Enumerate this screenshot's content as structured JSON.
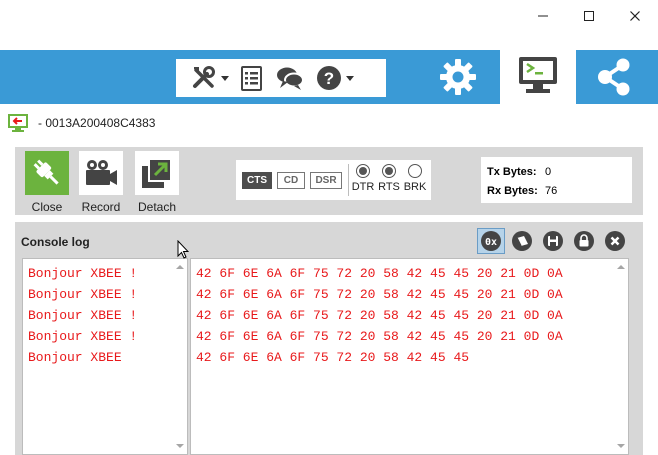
{
  "window": {
    "controls": [
      {
        "name": "minimize-button",
        "icon": "minimize-icon"
      },
      {
        "name": "maximize-button",
        "icon": "maximize-icon"
      },
      {
        "name": "close-window-button",
        "icon": "close-icon"
      }
    ]
  },
  "toolbar": {
    "tools": [
      {
        "icon": "tools-icon",
        "has_dropdown": true
      },
      {
        "icon": "list-icon",
        "has_dropdown": false
      },
      {
        "icon": "chat-icon",
        "has_dropdown": false
      },
      {
        "icon": "help-icon",
        "has_dropdown": true
      }
    ],
    "modes": [
      {
        "icon": "gear-icon",
        "active": false
      },
      {
        "icon": "console-icon",
        "active": true
      },
      {
        "icon": "network-icon",
        "active": false
      }
    ],
    "colors": {
      "band": "#3a9ad6",
      "accent_green": "#6cb33e"
    }
  },
  "device": {
    "name": "- 0013A200408C4383",
    "icon": "device-console-icon"
  },
  "actions": [
    {
      "label": "Close",
      "icon": "plug-icon"
    },
    {
      "label": "Record",
      "icon": "video-camera-icon"
    },
    {
      "label": "Detach",
      "icon": "detach-icon"
    }
  ],
  "signals": {
    "inputs": [
      {
        "label": "CTS",
        "active": true
      },
      {
        "label": "CD",
        "active": false
      },
      {
        "label": "DSR",
        "active": false
      }
    ],
    "lines": [
      {
        "label": "DTR",
        "checked": true
      },
      {
        "label": "RTS",
        "checked": true
      },
      {
        "label": "BRK",
        "checked": false
      }
    ]
  },
  "bytes": {
    "tx_label": "Tx Bytes:",
    "tx_value": "0",
    "rx_label": "Rx Bytes:",
    "rx_value": "76"
  },
  "console": {
    "title": "Console log",
    "tools": [
      {
        "icon": "hex-0x-icon",
        "text": "0x",
        "active": true
      },
      {
        "icon": "clear-icon",
        "active": false
      },
      {
        "icon": "save-icon",
        "active": false
      },
      {
        "icon": "lock-icon",
        "active": false
      },
      {
        "icon": "close-circle-icon",
        "active": false
      }
    ],
    "ascii_lines": [
      "Bonjour XBEE !",
      "Bonjour XBEE !",
      "Bonjour XBEE !",
      "Bonjour XBEE !",
      "Bonjour XBEE"
    ],
    "hex_lines": [
      "42 6F 6E 6A 6F 75 72 20 58 42 45 45 20 21 0D 0A",
      "42 6F 6E 6A 6F 75 72 20 58 42 45 45 20 21 0D 0A",
      "42 6F 6E 6A 6F 75 72 20 58 42 45 45 20 21 0D 0A",
      "42 6F 6E 6A 6F 75 72 20 58 42 45 45 20 21 0D 0A",
      "42 6F 6E 6A 6F 75 72 20 58 42 45 45"
    ],
    "text_color": "#e8191b"
  }
}
